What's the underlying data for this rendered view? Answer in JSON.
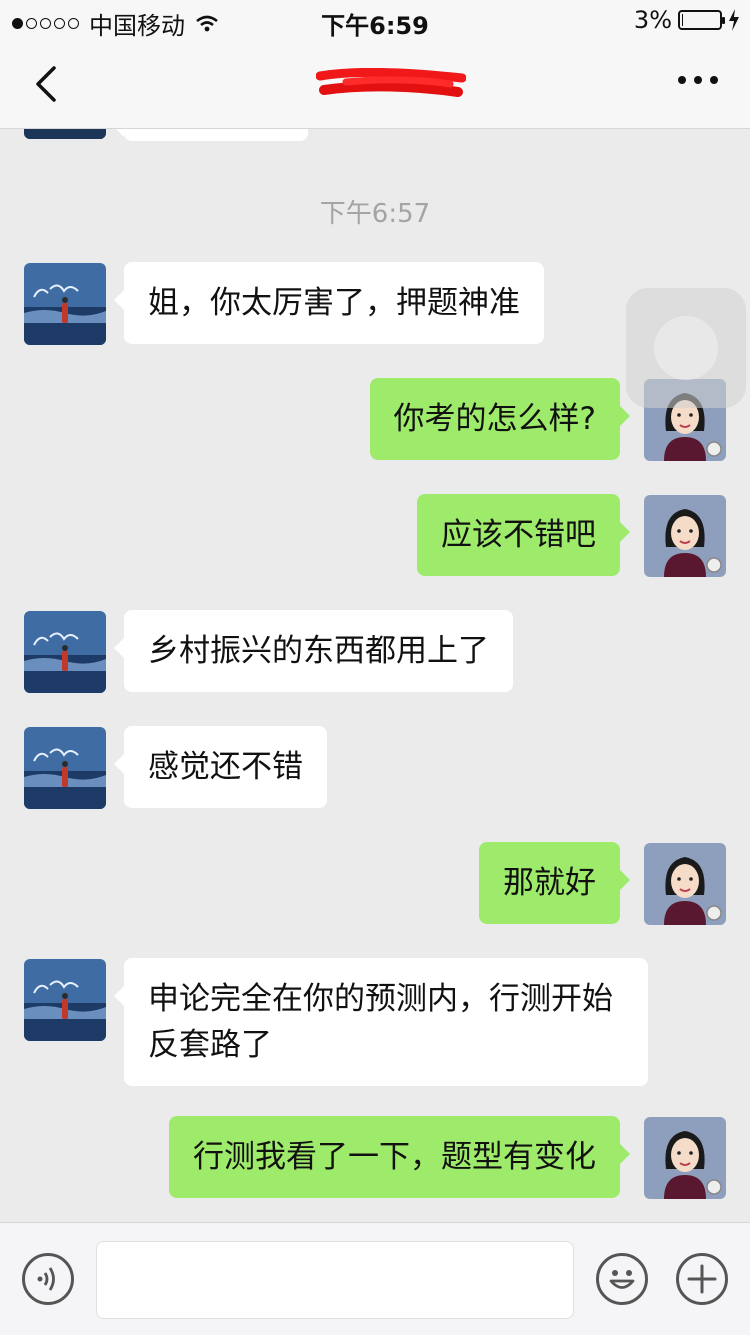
{
  "status": {
    "carrier": "中国移动",
    "time": "下午6:59",
    "battery": "3%",
    "battery_level": 0.03
  },
  "nav": {
    "title": "",
    "back_icon": "chevron-left-icon",
    "more_icon": "more-dots-icon"
  },
  "chat": {
    "timestamp": "下午6:57",
    "messages": [
      {
        "side": "in",
        "text": "姐，你太厉害了，押题神准"
      },
      {
        "side": "out",
        "text": "你考的怎么样?"
      },
      {
        "side": "out",
        "text": "应该不错吧"
      },
      {
        "side": "in",
        "text": "乡村振兴的东西都用上了"
      },
      {
        "side": "in",
        "text": "感觉还不错"
      },
      {
        "side": "out",
        "text": "那就好"
      },
      {
        "side": "in",
        "text": "申论完全在你的预测内，行测开始反套路了"
      },
      {
        "side": "out",
        "text": "行测我看了一下，题型有变化"
      }
    ]
  },
  "input": {
    "value": "",
    "voice_icon": "voice-icon",
    "emoji_icon": "emoji-icon",
    "add_icon": "plus-icon"
  },
  "colors": {
    "out_bubble": "#9eea6a",
    "in_bubble": "#ffffff",
    "background": "#ebebeb"
  }
}
